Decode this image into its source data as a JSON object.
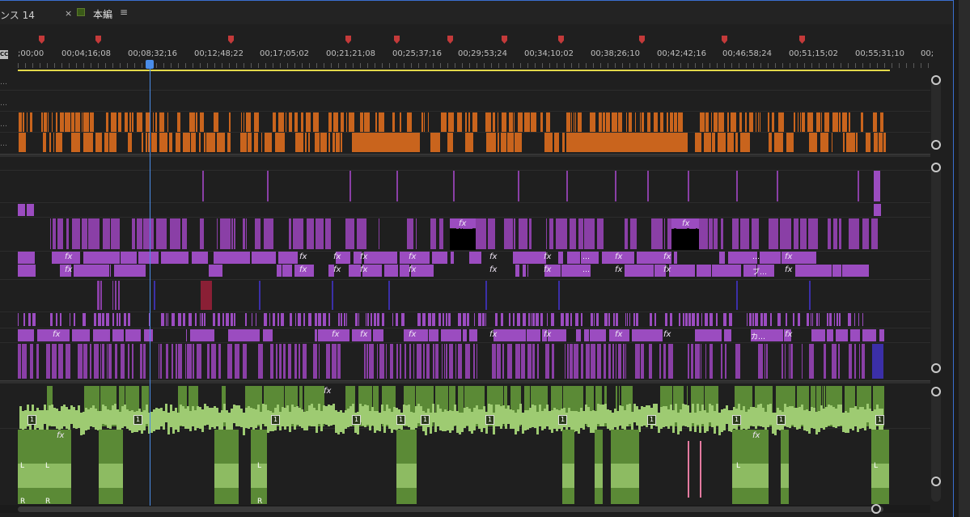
{
  "tabs": {
    "left_partial_label": "ンス 14",
    "active": {
      "close": "×",
      "label": "本編",
      "menu": "≡"
    }
  },
  "ruler": {
    "timecodes": [
      ";00;00",
      "00;04;16;08",
      "00;08;32;16",
      "00;12;48;22",
      "00;17;05;02",
      "00;21;21;08",
      "00;25;37;16",
      "00;29;53;24",
      "00;34;10;02",
      "00;38;26;10",
      "00;42;42;16",
      "00;46;58;24",
      "00;51;15;02",
      "00;55;31;10",
      "00;"
    ],
    "tc_chip": "CC"
  },
  "tracks": {
    "fx_label": "fx",
    "clip_text_a": "…",
    "clip_text_b": "ブ…",
    "clip_text_c": "カ…",
    "audio_badge": "1",
    "channel_left": "L",
    "channel_right": "R",
    "overflow_dots": "…"
  },
  "colors": {
    "accent": "#4a8de8",
    "marker": "#c43a3a",
    "workarea": "#e2d84a",
    "orange_clip": "#c9641d",
    "purple_clip": "#8a3fa6",
    "audio_clip": "#5b8a36"
  }
}
